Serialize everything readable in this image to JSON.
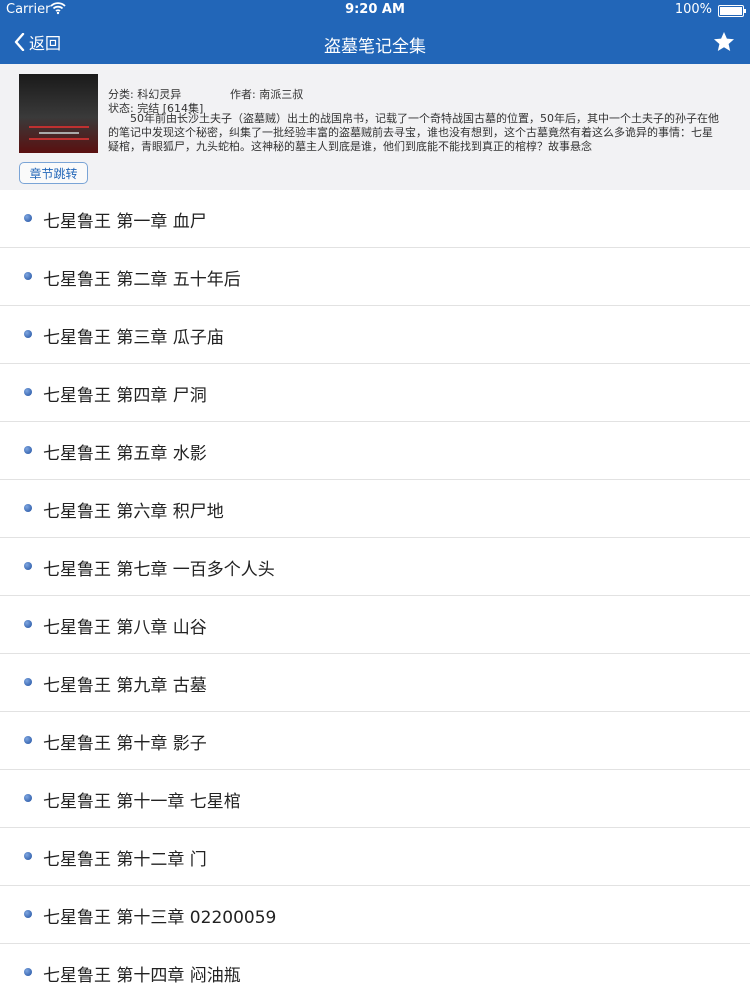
{
  "status_bar": {
    "carrier": "Carrier",
    "time": "9:20 AM",
    "battery": "100%"
  },
  "nav": {
    "back_label": "返回",
    "title": "盗墓笔记全集",
    "favorite_icon": "star-icon"
  },
  "book": {
    "category_label": "分类: 科幻灵异",
    "author_label": "作者: 南派三叔",
    "status_label": "状态: 完结 [614集]",
    "summary": "50年前由长沙土夫子（盗墓贼）出土的战国帛书，记载了一个奇特战国古墓的位置，50年后，其中一个土夫子的孙子在他的笔记中发现这个秘密，纠集了一批经验丰富的盗墓贼前去寻宝，谁也没有想到，这个古墓竟然有着这么多诡异的事情：七星疑棺，青眼狐尸，九头蛇柏。这神秘的墓主人到底是谁，他们到底能不能找到真正的棺椁？故事悬念",
    "jump_button": "章节跳转"
  },
  "chapters": [
    "七星鲁王 第一章 血尸",
    "七星鲁王 第二章 五十年后",
    "七星鲁王 第三章 瓜子庙",
    "七星鲁王 第四章 尸洞",
    "七星鲁王 第五章 水影",
    "七星鲁王 第六章 积尸地",
    "七星鲁王 第七章 一百多个人头",
    "七星鲁王 第八章 山谷",
    "七星鲁王 第九章 古墓",
    "七星鲁王 第十章 影子",
    "七星鲁王 第十一章 七星棺",
    "七星鲁王 第十二章 门",
    "七星鲁王 第十三章 02200059",
    "七星鲁王 第十四章 闷油瓶"
  ],
  "colors": {
    "nav_bar": "#2266b8",
    "accent": "#2266b8"
  }
}
